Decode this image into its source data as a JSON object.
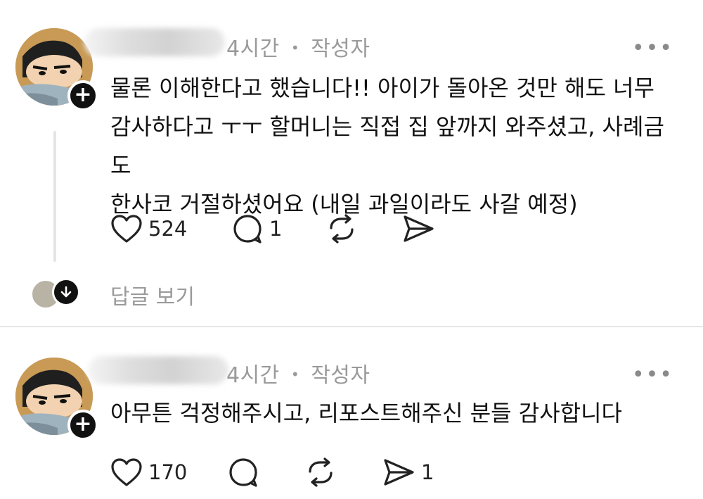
{
  "comments": [
    {
      "time": "4시간",
      "separator": "•",
      "author_tag": "작성자",
      "more": "•••",
      "text_lines": [
        "물론 이해한다고 했습니다!! 아이가 돌아온 것만 해도 너무",
        "감사하다고 ㅜㅜ 할머니는 직접 집 앞까지 와주셨고, 사례금도",
        "한사코 거절하셨어요 (내일 과일이라도 사갈 예정)"
      ],
      "likes": "524",
      "replies_count": "1",
      "shares_count": "",
      "view_replies": "답글 보기"
    },
    {
      "time": "4시간",
      "separator": "•",
      "author_tag": "작성자",
      "more": "•••",
      "text_lines": [
        "아무튼 걱정해주시고, 리포스트해주신 분들 감사합니다"
      ],
      "likes": "170",
      "replies_count": "",
      "shares_count": "1"
    }
  ],
  "icons": {
    "heart": "heart-icon",
    "reply": "reply-bubble-icon",
    "repost": "repost-icon",
    "share": "send-icon",
    "follow": "plus-icon",
    "expand": "arrow-down-icon"
  },
  "colors": {
    "text": "#111111",
    "muted": "#9a9a9a",
    "divider": "#e6e6e6",
    "badge": "#111111"
  }
}
